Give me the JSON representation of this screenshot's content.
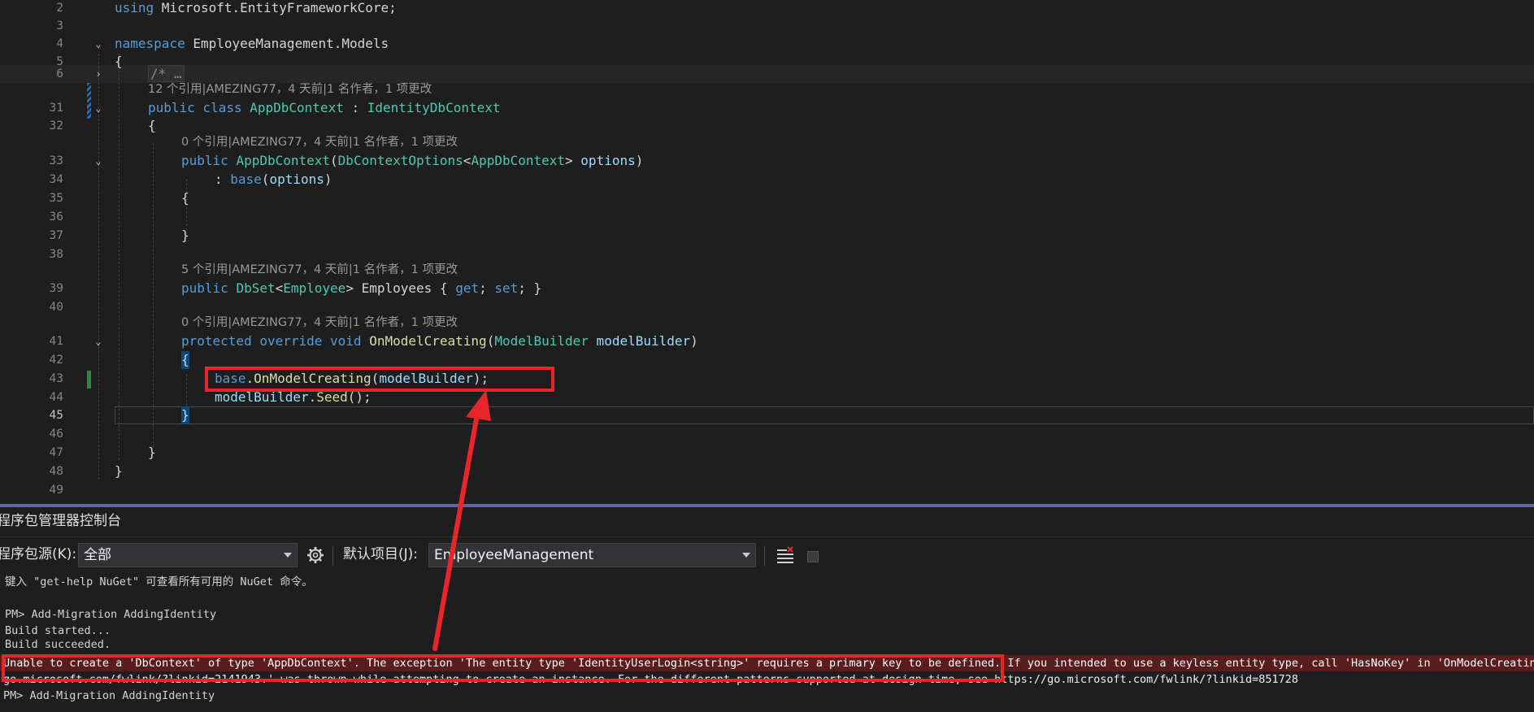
{
  "editor": {
    "line_numbers": {
      "l2": "2",
      "l3": "3",
      "l4": "4",
      "l5": "5",
      "l6": "6",
      "l31": "31",
      "l32": "32",
      "l33": "33",
      "l34": "34",
      "l35": "35",
      "l36": "36",
      "l37": "37",
      "l38": "38",
      "l39": "39",
      "l40": "40",
      "l41": "41",
      "l42": "42",
      "l43": "43",
      "l44": "44",
      "l45": "45",
      "l46": "46",
      "l47": "47",
      "l48": "48",
      "l49": "49"
    },
    "code": {
      "using_kw": "using",
      "using_ns": " Microsoft.EntityFrameworkCore;",
      "namespace_kw": "namespace",
      "namespace_name": " EmployeeManagement.Models",
      "open_brace": "{",
      "collapsed_comment": "/* …",
      "class_mods": "public class ",
      "class_name": "AppDbContext",
      "class_colon": " : ",
      "class_base": "IdentityDbContext",
      "ctor_public": "public ",
      "ctor_name": "AppDbContext",
      "ctor_paren": "(",
      "ctor_ptype": "DbContextOptions",
      "ctor_lt": "<",
      "ctor_gtype": "AppDbContext",
      "ctor_gt": "> ",
      "ctor_pname": "options",
      "ctor_close": ")",
      "base_colon": ": ",
      "base_kw": "base",
      "base_args_open": "(",
      "base_args_name": "options",
      "base_args_close": ")",
      "brace_open": "{",
      "brace_close": "}",
      "prop_public": "public ",
      "prop_type": "DbSet",
      "prop_lt": "<",
      "prop_gtype": "Employee",
      "prop_gt": "> ",
      "prop_name": "Employees",
      "prop_acc_open": " { ",
      "prop_get": "get",
      "prop_semi1": "; ",
      "prop_set": "set",
      "prop_acc_close": "; }",
      "method_mods": "protected override void ",
      "method_name": "OnModelCreating",
      "method_paren": "(",
      "method_ptype": "ModelBuilder",
      "method_pname": " modelBuilder",
      "method_close": ")",
      "call1_base": "base",
      "call1_dot": ".",
      "call1_fn": "OnModelCreating",
      "call1_open": "(",
      "call1_arg": "modelBuilder",
      "call1_close": ");",
      "call2_obj": "modelBuilder",
      "call2_dot": ".",
      "call2_fn": "Seed",
      "call2_rest": "();"
    },
    "codelens": {
      "class_refs": "12 个引用|AMEZING77，4 天前|1 名作者，1 项更改",
      "ctor_refs": "0 个引用|AMEZING77，4 天前|1 名作者，1 项更改",
      "prop_refs": "5 个引用|AMEZING77，4 天前|1 名作者，1 项更改",
      "method_refs": "0 个引用|AMEZING77，4 天前|1 名作者，1 项更改"
    }
  },
  "pmc": {
    "title": "程序包管理器控制台",
    "source_label": "程序包源(K):",
    "source_value": "全部",
    "default_project_label": "默认项目(J):",
    "default_project_value": "EmployeeManagement",
    "output": {
      "hint": "键入 \"get-help NuGet\" 可查看所有可用的 NuGet 命令。",
      "cmd1": "PM> Add-Migration AddingIdentity",
      "build_started": "Build started...",
      "build_succeeded": "Build succeeded.",
      "error1": "Unable to create a 'DbContext' of type 'AppDbContext'. The exception 'The entity type 'IdentityUserLogin<string>' requires a primary key to be defined. If you intended to use a keyless entity type, call 'HasNoKey' in 'OnModelCreating'.",
      "error2": "go.microsoft.com/fwlink/?linkid=2141943.' was thrown while attempting to create an instance. For the different patterns supported at design time, see https://go.microsoft.com/fwlink/?linkid=851728",
      "cmd2": "PM> Add-Migration AddingIdentity"
    }
  },
  "colors": {
    "annotation_red": "#e8262a",
    "keyword": "#569cd6",
    "type": "#4ec9b0",
    "method": "#dcdcaa",
    "error_text": "#f48771"
  },
  "icons": [
    "fold-chevron-icon",
    "settings-gear-icon",
    "clear-console-icon",
    "stop-icon",
    "dropdown-arrow-icon"
  ]
}
